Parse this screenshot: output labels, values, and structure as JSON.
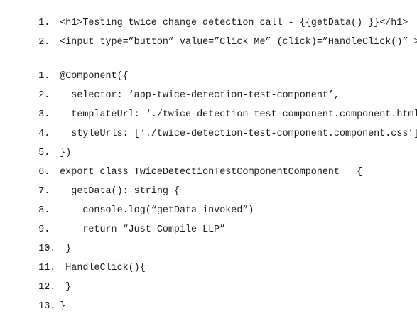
{
  "snippet_html": {
    "lines": [
      {
        "num": "1.",
        "code": "<h1>Testing twice change detection call - {{getData() }}</h1>"
      },
      {
        "num": "2.",
        "code": "<input type=”button” value=”Click Me” (click)=”HandleClick()” >"
      }
    ]
  },
  "snippet_ts": {
    "lines": [
      {
        "num": "1.",
        "code": "@Component({"
      },
      {
        "num": "2.",
        "code": "  selector: ‘app-twice-detection-test-component’,"
      },
      {
        "num": "3.",
        "code": "  templateUrl: ‘./twice-detection-test-component.component.html’,"
      },
      {
        "num": "4.",
        "code": "  styleUrls: [‘./twice-detection-test-component.component.css’]"
      },
      {
        "num": "5.",
        "code": "})"
      },
      {
        "num": "6.",
        "code": "export class TwiceDetectionTestComponentComponent   {"
      },
      {
        "num": "7.",
        "code": "  getData(): string {"
      },
      {
        "num": "8.",
        "code": "    console.log(“getData invoked”)"
      },
      {
        "num": "9.",
        "code": "    return “Just Compile LLP”"
      },
      {
        "num": "10.",
        "code": " }"
      },
      {
        "num": "11.",
        "code": " HandleClick(){"
      },
      {
        "num": "12.",
        "code": " }"
      },
      {
        "num": "13.",
        "code": "}"
      }
    ]
  }
}
